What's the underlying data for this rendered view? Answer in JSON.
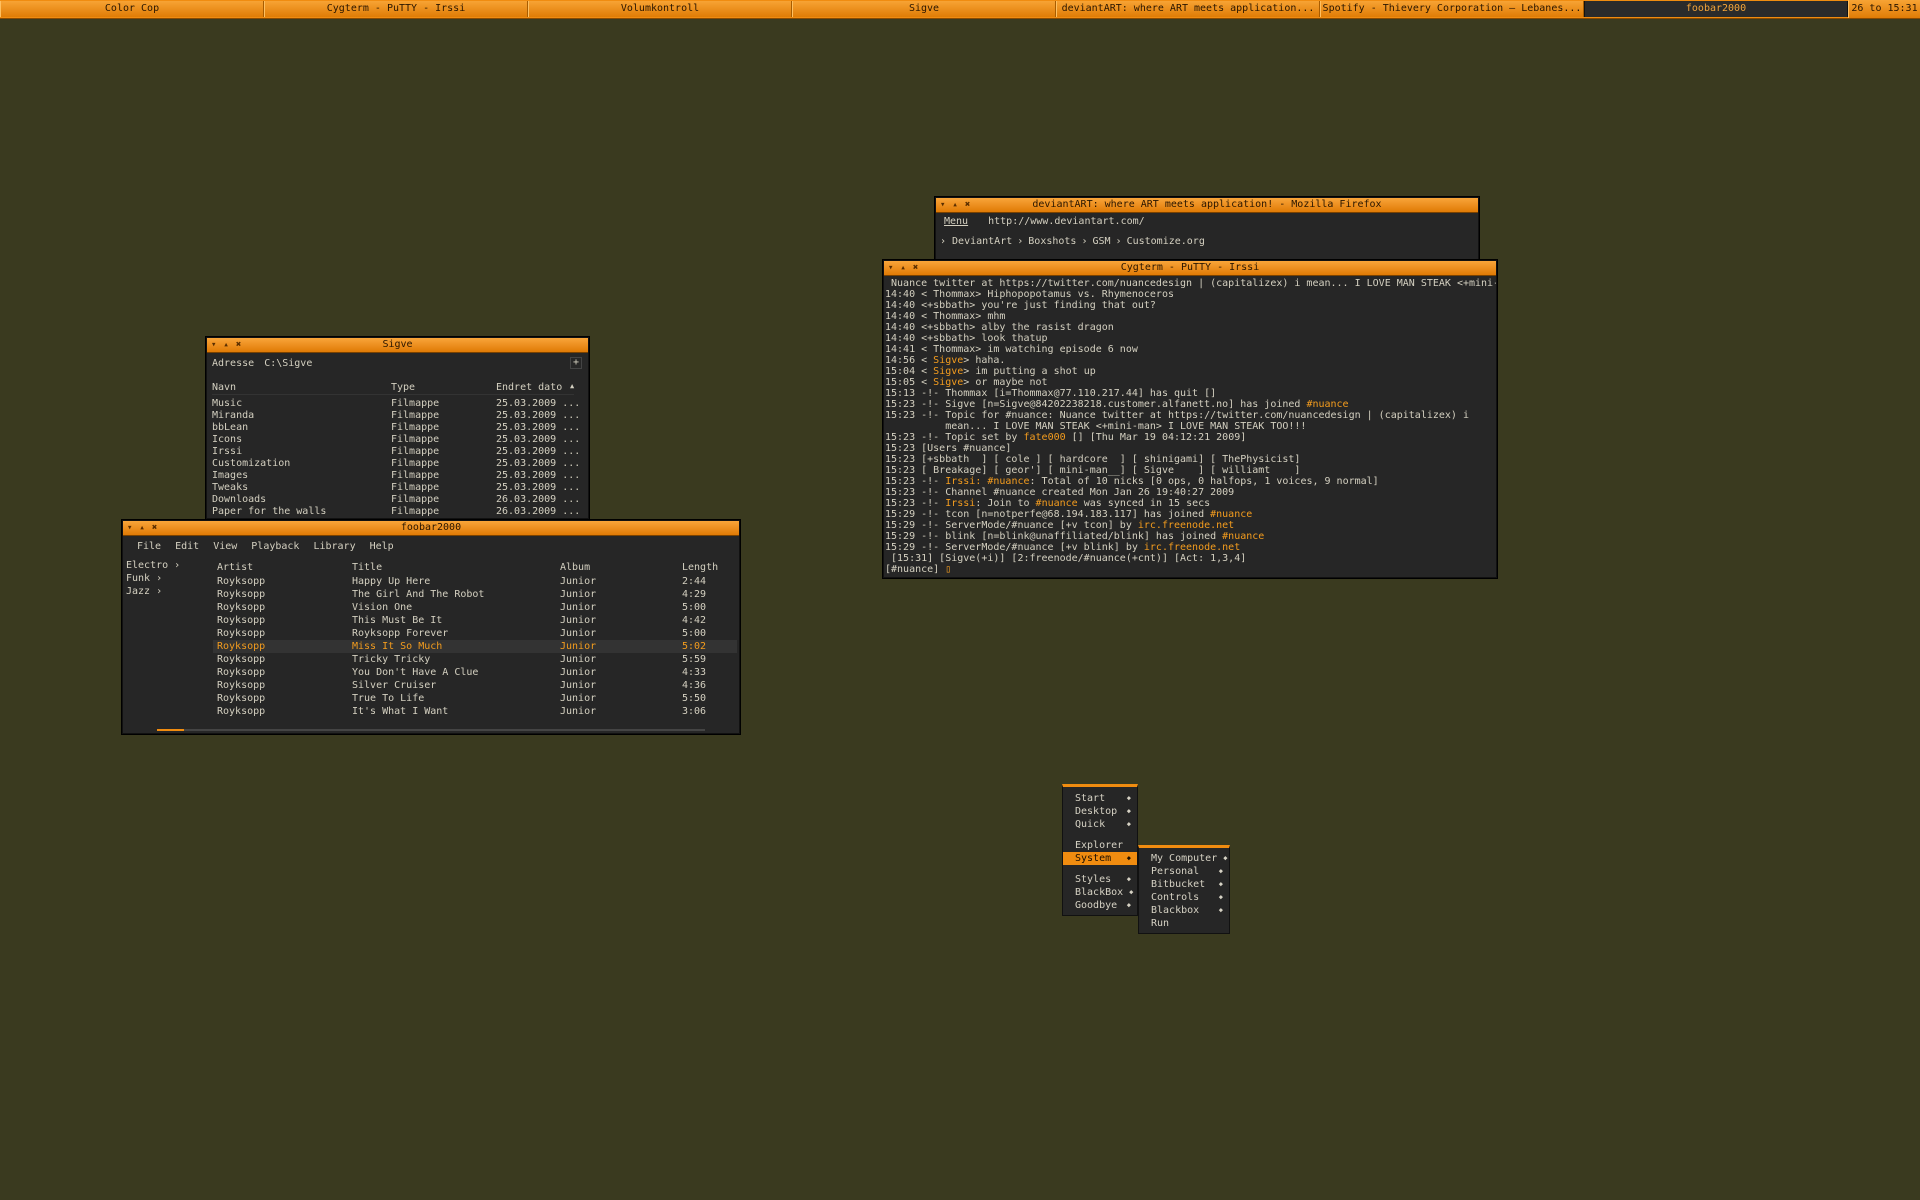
{
  "colors": {
    "desktop": "#3a3a1f",
    "accent": "#f08c10",
    "window_bg": "#262626",
    "text": "#d4d0c0"
  },
  "taskbar": {
    "tasks": [
      {
        "label": "Color Cop",
        "active": false
      },
      {
        "label": "Cygterm - PuTTY - Irssi",
        "active": false
      },
      {
        "label": "Volumkontroll",
        "active": false
      },
      {
        "label": "Sigve",
        "active": false
      },
      {
        "label": "deviantART: where ART meets application...",
        "active": false
      },
      {
        "label": "Spotify - Thievery Corporation – Lebanes...",
        "active": false
      },
      {
        "label": "foobar2000",
        "active": true
      }
    ],
    "clock": "26 to 15:31"
  },
  "window_buttons": {
    "minimize": "▾",
    "maximize": "▴",
    "close": "✖"
  },
  "firefox": {
    "title": "deviantART: where ART meets application! - Mozilla Firefox",
    "menu_label": "Menu",
    "url": "http://www.deviantart.com/",
    "bookmarks_prefix": "›",
    "bookmarks": [
      "DeviantArt",
      "Boxshots",
      "GSM",
      "Customize.org"
    ],
    "separator": "›"
  },
  "irssi": {
    "title": "Cygterm - PuTTY - Irssi",
    "lines": [
      [
        {
          "t": " Nuance twitter at https://twitter.com/nuancedesign | (capitalizex) i mean... I LOVE MAN STEAK <+mini-"
        }
      ],
      [
        {
          "t": "14:40 < Thommax> Hiphopopotamus vs. Rhymenoceros"
        }
      ],
      [
        {
          "t": "14:40 <+sbbath> you're just finding that out?"
        }
      ],
      [
        {
          "t": "14:40 < Thommax> mhm"
        }
      ],
      [
        {
          "t": "14:40 <+sbbath> alby the rasist dragon"
        }
      ],
      [
        {
          "t": "14:40 <+sbbath> look thatup"
        }
      ],
      [
        {
          "t": "14:41 < Thommax> im watching episode 6 now"
        }
      ],
      [
        {
          "t": "14:56 < "
        },
        {
          "t": "Sigve",
          "o": true
        },
        {
          "t": "> haha."
        }
      ],
      [
        {
          "t": "15:04 < "
        },
        {
          "t": "Sigve",
          "o": true
        },
        {
          "t": "> im putting a shot up"
        }
      ],
      [
        {
          "t": "15:05 < "
        },
        {
          "t": "Sigve",
          "o": true
        },
        {
          "t": "> or maybe not"
        }
      ],
      [
        {
          "t": "15:13 -!- Thommax [i=Thommax@77.110.217.44] has quit []"
        }
      ],
      [
        {
          "t": "15:23 -!- Sigve [n=Sigve@84202238218.customer.alfanett.no] has joined "
        },
        {
          "t": "#nuance",
          "o": true
        }
      ],
      [
        {
          "t": "15:23 -!- Topic for #nuance: Nuance twitter at https://twitter.com/nuancedesign | (capitalizex) i"
        }
      ],
      [
        {
          "t": "          mean... I LOVE MAN STEAK <+mini-man> I LOVE MAN STEAK TOO!!!"
        }
      ],
      [
        {
          "t": "15:23 -!- Topic set by "
        },
        {
          "t": "fate000",
          "o": true
        },
        {
          "t": " [] [Thu Mar 19 04:12:21 2009]"
        }
      ],
      [
        {
          "t": "15:23 [Users #nuance]"
        }
      ],
      [
        {
          "t": "15:23 [+sbbath  ] [ cole ] [ hardcore  ] [ shinigami] [ ThePhysicist]"
        }
      ],
      [
        {
          "t": "15:23 [ Breakage] [ geor'] [ mini-man__] [ Sigve    ] [ williamt    ]"
        }
      ],
      [
        {
          "t": "15:23 -!- "
        },
        {
          "t": "Irssi: #nuance",
          "o": true
        },
        {
          "t": ": Total of 10 nicks [0 ops, 0 halfops, 1 voices, 9 normal]"
        }
      ],
      [
        {
          "t": "15:23 -!- Channel #nuance created Mon Jan 26 19:40:27 2009"
        }
      ],
      [
        {
          "t": "15:23 -!- "
        },
        {
          "t": "Irssi",
          "o": true
        },
        {
          "t": ": Join to "
        },
        {
          "t": "#nuance",
          "o": true
        },
        {
          "t": " was synced in 15 secs"
        }
      ],
      [
        {
          "t": "15:29 -!- tcon [n=notperfe@68.194.183.117] has joined "
        },
        {
          "t": "#nuance",
          "o": true
        }
      ],
      [
        {
          "t": "15:29 -!- ServerMode/#nuance [+v tcon] by "
        },
        {
          "t": "irc.freenode.net",
          "o": true
        }
      ],
      [
        {
          "t": "15:29 -!- blink [n=blink@unaffiliated/blink] has joined "
        },
        {
          "t": "#nuance",
          "o": true
        }
      ],
      [
        {
          "t": "15:29 -!- ServerMode/#nuance [+v blink] by "
        },
        {
          "t": "irc.freenode.net",
          "o": true
        }
      ],
      [
        {
          "t": " [15:31] [Sigve(+i)] [2:freenode/#nuance(+cnt)] [Act: 1,3,4]"
        }
      ],
      [
        {
          "t": "[#nuance] "
        },
        {
          "t": "▯",
          "o": true
        }
      ]
    ]
  },
  "explorer": {
    "title": "Sigve",
    "address_label": "Adresse",
    "address": "C:\\Sigve",
    "go": "+",
    "columns": [
      "Navn",
      "Type",
      "Endret dato"
    ],
    "sort_indicator": "▲",
    "rows": [
      {
        "name": "Music",
        "type": "Filmappe",
        "date": "25.03.2009 ..."
      },
      {
        "name": "Miranda",
        "type": "Filmappe",
        "date": "25.03.2009 ..."
      },
      {
        "name": "bbLean",
        "type": "Filmappe",
        "date": "25.03.2009 ..."
      },
      {
        "name": "Icons",
        "type": "Filmappe",
        "date": "25.03.2009 ..."
      },
      {
        "name": "Irssi",
        "type": "Filmappe",
        "date": "25.03.2009 ..."
      },
      {
        "name": "Customization",
        "type": "Filmappe",
        "date": "25.03.2009 ..."
      },
      {
        "name": "Images",
        "type": "Filmappe",
        "date": "25.03.2009 ..."
      },
      {
        "name": "Tweaks",
        "type": "Filmappe",
        "date": "25.03.2009 ..."
      },
      {
        "name": "Downloads",
        "type": "Filmappe",
        "date": "26.03.2009 ..."
      },
      {
        "name": "Paper for the walls",
        "type": "Filmappe",
        "date": "26.03.2009 ..."
      }
    ]
  },
  "foobar": {
    "title": "foobar2000",
    "menu": [
      "File",
      "Edit",
      "View",
      "Playback",
      "Library",
      "Help"
    ],
    "genres": [
      "Electro ›",
      "Funk ›",
      "Jazz ›"
    ],
    "columns": [
      "Artist",
      "Title",
      "Album",
      "Length"
    ],
    "tracks": [
      {
        "artist": "Royksopp",
        "title": "Happy Up Here",
        "album": "Junior",
        "length": "2:44",
        "playing": false
      },
      {
        "artist": "Royksopp",
        "title": "The Girl And The Robot",
        "album": "Junior",
        "length": "4:29",
        "playing": false
      },
      {
        "artist": "Royksopp",
        "title": "Vision One",
        "album": "Junior",
        "length": "5:00",
        "playing": false
      },
      {
        "artist": "Royksopp",
        "title": "This Must Be It",
        "album": "Junior",
        "length": "4:42",
        "playing": false
      },
      {
        "artist": "Royksopp",
        "title": "Royksopp Forever",
        "album": "Junior",
        "length": "5:00",
        "playing": false
      },
      {
        "artist": "Royksopp",
        "title": "Miss It So Much",
        "album": "Junior",
        "length": "5:02",
        "playing": true
      },
      {
        "artist": "Royksopp",
        "title": "Tricky Tricky",
        "album": "Junior",
        "length": "5:59",
        "playing": false
      },
      {
        "artist": "Royksopp",
        "title": "You Don't Have A Clue",
        "album": "Junior",
        "length": "4:33",
        "playing": false
      },
      {
        "artist": "Royksopp",
        "title": "Silver Cruiser",
        "album": "Junior",
        "length": "4:36",
        "playing": false
      },
      {
        "artist": "Royksopp",
        "title": "True To Life",
        "album": "Junior",
        "length": "5:50",
        "playing": false
      },
      {
        "artist": "Royksopp",
        "title": "It's What I Want",
        "album": "Junior",
        "length": "3:06",
        "playing": false
      }
    ],
    "progress": 0.05
  },
  "root_menu": {
    "items": [
      {
        "label": "Start",
        "sub": true
      },
      {
        "label": "Desktop",
        "sub": true
      },
      {
        "label": "Quick",
        "sub": true
      },
      {
        "label": "",
        "sep": true
      },
      {
        "label": "Explorer",
        "sub": false
      },
      {
        "label": "System",
        "sub": true,
        "hl": true
      },
      {
        "label": "",
        "sep": true
      },
      {
        "label": "Styles",
        "sub": true
      },
      {
        "label": "BlackBox",
        "sub": true
      },
      {
        "label": "Goodbye",
        "sub": true
      }
    ],
    "arrow": "◆"
  },
  "system_menu": {
    "items": [
      {
        "label": "My Computer",
        "sub": true
      },
      {
        "label": "Personal",
        "sub": true
      },
      {
        "label": "Bitbucket",
        "sub": true
      },
      {
        "label": "Controls",
        "sub": true
      },
      {
        "label": "Blackbox",
        "sub": true
      },
      {
        "label": "Run",
        "sub": false
      }
    ]
  }
}
